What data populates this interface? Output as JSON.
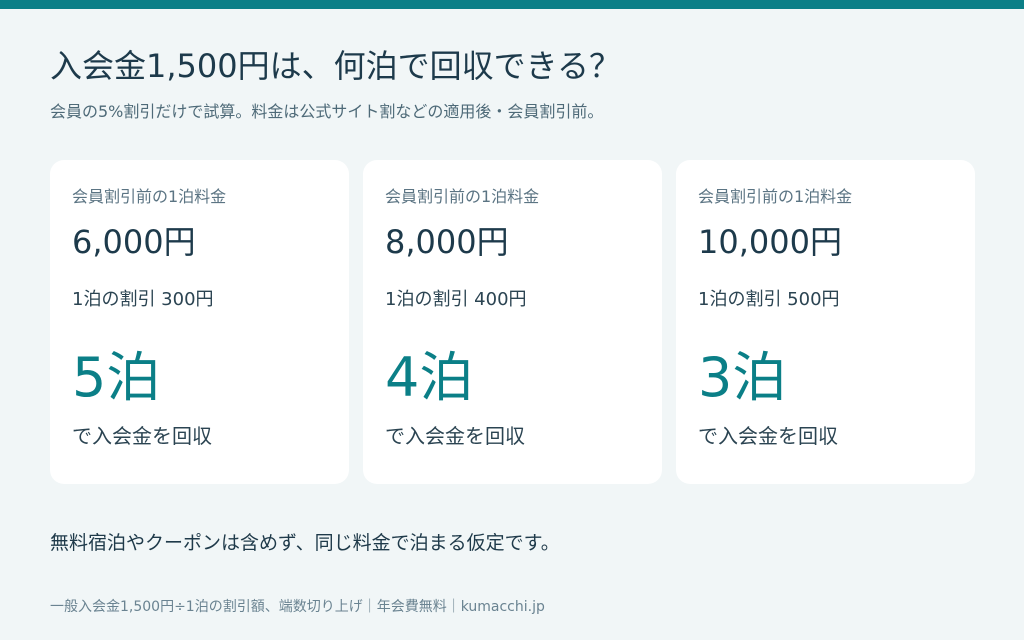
{
  "title": "入会金1,500円は、何泊で回収できる？",
  "subtitle": "会員の5%割引だけで試算。料金は公式サイト割などの適用後・会員割引前。",
  "cards": [
    {
      "label": "会員割引前の1泊料金",
      "price": "6,000円",
      "discount": "1泊の割引 300円",
      "nights": "5泊",
      "recover": "で入会金を回収"
    },
    {
      "label": "会員割引前の1泊料金",
      "price": "8,000円",
      "discount": "1泊の割引 400円",
      "nights": "4泊",
      "recover": "で入会金を回収"
    },
    {
      "label": "会員割引前の1泊料金",
      "price": "10,000円",
      "discount": "1泊の割引 500円",
      "nights": "3泊",
      "recover": "で入会金を回収"
    }
  ],
  "note": "無料宿泊やクーポンは含めず、同じ料金で泊まる仮定です。",
  "footer": "一般入会金1,500円÷1泊の割引額、端数切り上げ｜年会費無料｜kumacchi.jp",
  "colors": {
    "accent": "#0b7f87",
    "background": "#f1f6f7",
    "card": "#ffffff",
    "text": "#1d3a4b"
  }
}
